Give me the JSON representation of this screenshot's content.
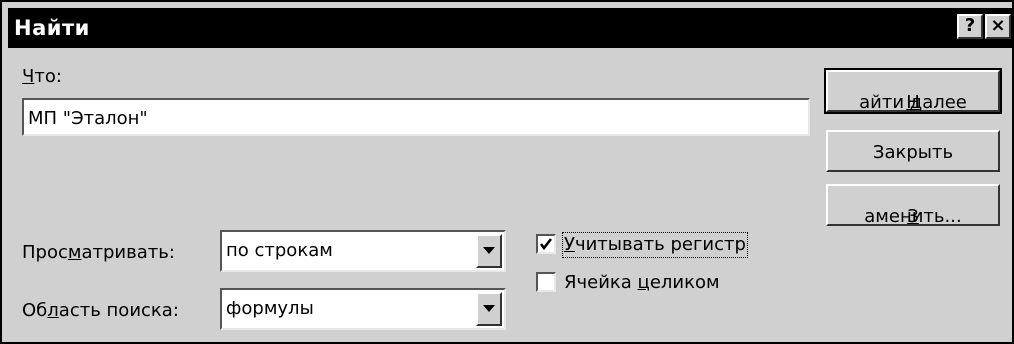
{
  "dialog": {
    "title": "Найти",
    "help_button": "?",
    "close_button": "×"
  },
  "find": {
    "label_prefix": "",
    "label_accel": "Ч",
    "label_rest": "то:",
    "value": "МП \"Эталон\""
  },
  "buttons": {
    "find_next": {
      "accel": "Н",
      "rest": "айти далее"
    },
    "close": {
      "text": "Закрыть"
    },
    "replace": {
      "accel": "З",
      "rest": "аменить..."
    }
  },
  "browse": {
    "label_prefix": "Прос",
    "label_accel": "м",
    "label_rest": "атривать:",
    "value": "по строкам"
  },
  "lookin": {
    "label_prefix": "Об",
    "label_accel": "л",
    "label_rest": "асть поиска:",
    "value": "формулы"
  },
  "options": {
    "match_case": {
      "accel": "У",
      "rest": "читывать регистр",
      "checked": true
    },
    "whole_cell": {
      "prefix": "Ячейка ",
      "accel": "ц",
      "rest": "еликом",
      "checked": false
    }
  }
}
